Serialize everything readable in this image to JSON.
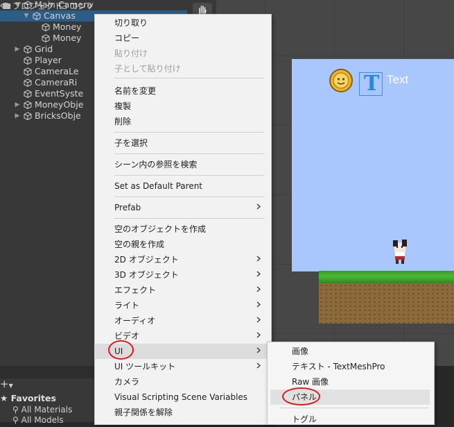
{
  "hierarchy": {
    "items": [
      {
        "label": "Main Camera",
        "indent": 2,
        "expandable": true,
        "selected": false
      },
      {
        "label": "Canvas",
        "indent": 3,
        "expandable": true,
        "selected": true
      },
      {
        "label": "Money",
        "indent": 4,
        "expandable": false,
        "selected": false
      },
      {
        "label": "Money",
        "indent": 4,
        "expandable": false,
        "selected": false
      },
      {
        "label": "Grid",
        "indent": 2,
        "expandable": true,
        "selected": false
      },
      {
        "label": "Player",
        "indent": 2,
        "expandable": false,
        "selected": false
      },
      {
        "label": "CameraLe",
        "indent": 2,
        "expandable": false,
        "selected": false
      },
      {
        "label": "CameraRi",
        "indent": 2,
        "expandable": false,
        "selected": false
      },
      {
        "label": "EventSyste",
        "indent": 2,
        "expandable": false,
        "selected": false
      },
      {
        "label": "MoneyObje",
        "indent": 2,
        "expandable": true,
        "selected": false
      },
      {
        "label": "BricksObje",
        "indent": 2,
        "expandable": true,
        "selected": false
      }
    ]
  },
  "scene": {
    "text_gizmo_label": "Text",
    "text_gizmo_glyph": "T"
  },
  "bottom_panel": {
    "tabs": [
      {
        "label": "プロジェクト",
        "icon": "folder-icon"
      },
      {
        "label": "コンソ",
        "icon": "console-icon"
      }
    ],
    "add_label": "+",
    "favorites_label": "Favorites",
    "favorites": [
      "All Materials",
      "All Models"
    ]
  },
  "context_menu": {
    "items": [
      {
        "label": "切り取り",
        "disabled": false
      },
      {
        "label": "コピー",
        "disabled": false
      },
      {
        "label": "貼り付け",
        "disabled": true
      },
      {
        "label": "子として貼り付け",
        "disabled": true
      },
      {
        "label": "名前を変更",
        "disabled": false
      },
      {
        "label": "複製",
        "disabled": false
      },
      {
        "label": "削除",
        "disabled": false
      },
      {
        "label": "子を選択",
        "disabled": false
      },
      {
        "label": "シーン内の参照を検索",
        "disabled": false
      },
      {
        "label": "Set as Default Parent",
        "disabled": false
      },
      {
        "label": "Prefab",
        "disabled": false,
        "submenu": true
      },
      {
        "label": "空のオブジェクトを作成",
        "disabled": false
      },
      {
        "label": "空の親を作成",
        "disabled": false
      },
      {
        "label": "2D オブジェクト",
        "disabled": false,
        "submenu": true
      },
      {
        "label": "3D オブジェクト",
        "disabled": false,
        "submenu": true
      },
      {
        "label": "エフェクト",
        "disabled": false,
        "submenu": true
      },
      {
        "label": "ライト",
        "disabled": false,
        "submenu": true
      },
      {
        "label": "オーディオ",
        "disabled": false,
        "submenu": true
      },
      {
        "label": "ビデオ",
        "disabled": false,
        "submenu": true
      },
      {
        "label": "UI",
        "disabled": false,
        "submenu": true,
        "highlighted": true
      },
      {
        "label": "UI ツールキット",
        "disabled": false,
        "submenu": true
      },
      {
        "label": "カメラ",
        "disabled": false
      },
      {
        "label": "Visual Scripting Scene Variables",
        "disabled": false
      },
      {
        "label": "親子関係を解除",
        "disabled": false
      }
    ],
    "submenu_arrow": "›"
  },
  "ui_submenu": {
    "items": [
      {
        "label": "画像"
      },
      {
        "label": "テキスト - TextMeshPro"
      },
      {
        "label": "Raw 画像"
      },
      {
        "label": "パネル",
        "highlighted": true
      },
      {
        "label": "トグル"
      }
    ]
  },
  "colors": {
    "selection": "#2c5d87",
    "annotation_red": "#e1171e",
    "sky": "#a9c6fd",
    "gizmo_blue": "#3e8ede"
  }
}
